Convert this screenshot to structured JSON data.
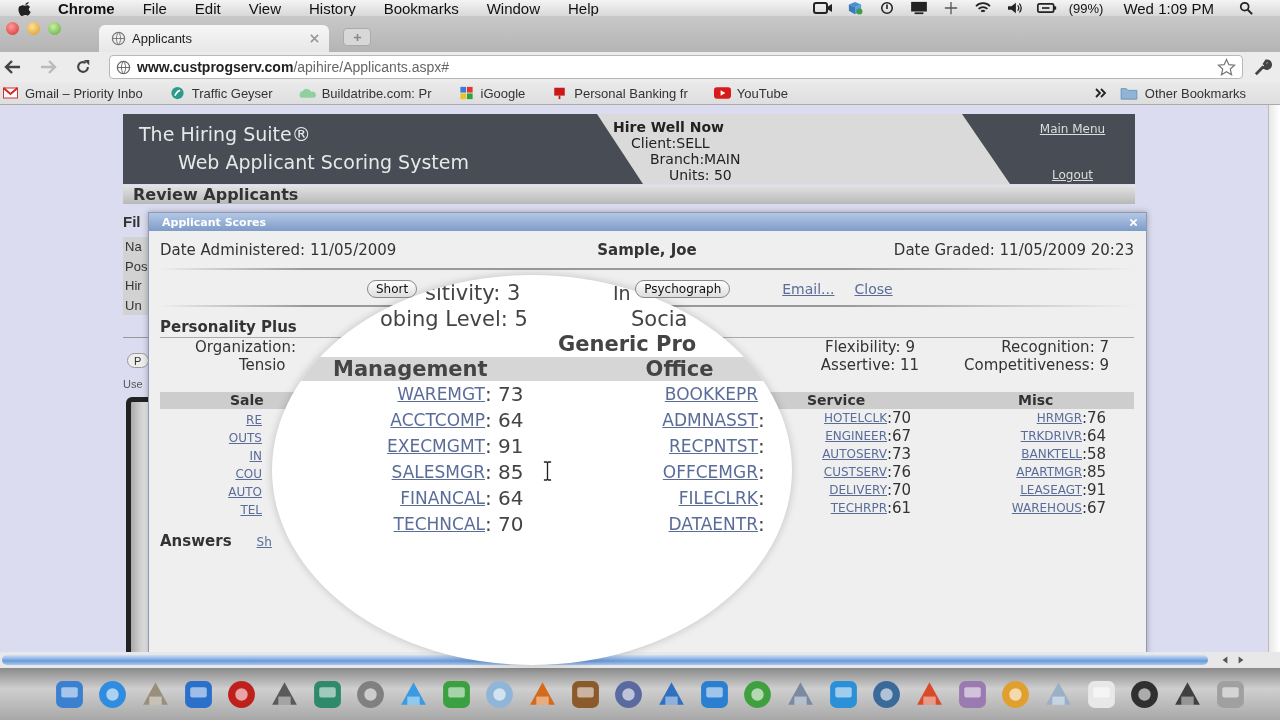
{
  "menubar": {
    "app": "Chrome",
    "menus": [
      "File",
      "Edit",
      "View",
      "History",
      "Bookmarks",
      "Window",
      "Help"
    ],
    "battery": "(99%)",
    "clock": "Wed 1:09 PM"
  },
  "tab": {
    "title": "Applicants"
  },
  "navigation": {
    "forward_disabled": true
  },
  "address": {
    "host": "www.custprogserv.com",
    "path": "/apihire/Applicants.aspx#"
  },
  "bookmarks": [
    {
      "label": "Gmail – Priority Inbo",
      "kind": "mail"
    },
    {
      "label": "Traffic Geyser",
      "kind": "geyser"
    },
    {
      "label": "Buildatribe.com: Pr",
      "kind": "cloud"
    },
    {
      "label": "iGoogle",
      "kind": "tiles"
    },
    {
      "label": "Personal Banking fr",
      "kind": "flag"
    },
    {
      "label": "YouTube",
      "kind": "video"
    }
  ],
  "other_bookmarks": "Other Bookmarks",
  "header": {
    "title": "The Hiring Suite®",
    "subtitle": "Web Applicant Scoring System",
    "tagline": "Hire Well Now",
    "details": [
      "Client:SELL",
      "Branch:MAIN",
      "Units: 50"
    ],
    "links": [
      "Main Menu",
      "Logout"
    ]
  },
  "page_heading": "Review Applicants",
  "behind": {
    "heading": "Fil",
    "fields": [
      "Na",
      "Pos",
      "Hir",
      "Un"
    ],
    "button": "P",
    "note": "Use"
  },
  "dialog": {
    "title": "Applicant Scores",
    "date_administered": "Date Administered: 11/05/2009",
    "applicant": "Sample, Joe",
    "date_graded": "Date Graded: 11/05/2009 20:23",
    "buttons": [
      "Short",
      "Psychograph"
    ],
    "links": [
      "Email...",
      "Close"
    ],
    "personality_heading": "Personality Plus",
    "traits": [
      {
        "left": "Organization:",
        "middle": "Flexibility: 9",
        "right": "Recognition: 7"
      },
      {
        "left": "Tensio",
        "middle": "Assertive: 11",
        "right": "Competitiveness: 9"
      }
    ],
    "sales": {
      "heading": "Sale",
      "items": [
        "RE",
        "OUTS",
        "IN",
        "COU",
        "AUTO",
        "TEL"
      ]
    },
    "service": {
      "heading": "Service",
      "items": [
        {
          "label": "HOTELCLK",
          "score": ":70"
        },
        {
          "label": "ENGINEER",
          "score": ":67"
        },
        {
          "label": "AUTOSERV",
          "score": ":73"
        },
        {
          "label": "CUSTSERV",
          "score": ":76"
        },
        {
          "label": "DELIVERY",
          "score": ":70"
        },
        {
          "label": "TECHRPR",
          "score": ":61"
        }
      ]
    },
    "misc": {
      "heading": "Misc",
      "items": [
        {
          "label": "HRMGR",
          "score": ":76"
        },
        {
          "label": "TRKDRIVR",
          "score": ":64"
        },
        {
          "label": "BANKTELL",
          "score": ":58"
        },
        {
          "label": "APARTMGR",
          "score": ":85"
        },
        {
          "label": "LEASEAGT",
          "score": ":91"
        },
        {
          "label": "WAREHOUS",
          "score": ":67"
        }
      ]
    },
    "answers": {
      "heading": "Answers",
      "link": "Sh"
    }
  },
  "magnifier": {
    "traits": [
      {
        "left": "sitivity: 3",
        "right": "In"
      },
      {
        "left": "obing Level: 5",
        "right": "Socia"
      }
    ],
    "heading": "Generic Pro",
    "columns": [
      "Management",
      "Office"
    ],
    "rows": [
      {
        "management": "WAREMGT",
        "score": ": 73",
        "office": "BOOKKEPR",
        "suffix": ""
      },
      {
        "management": "ACCTCOMP",
        "score": ": 64",
        "office": "ADMNASST",
        "suffix": ":"
      },
      {
        "management": "EXECMGMT",
        "score": ": 91",
        "office": "RECPNTST",
        "suffix": ":"
      },
      {
        "management": "SALESMGR",
        "score": ": 85",
        "office": "OFFCEMGR",
        "suffix": ":"
      },
      {
        "management": "FINANCAL",
        "score": ": 64",
        "office": "FILECLRK",
        "suffix": ":"
      },
      {
        "management": "TECHNCAL",
        "score": ": 70",
        "office": "DATAENTR",
        "suffix": ":"
      }
    ]
  }
}
